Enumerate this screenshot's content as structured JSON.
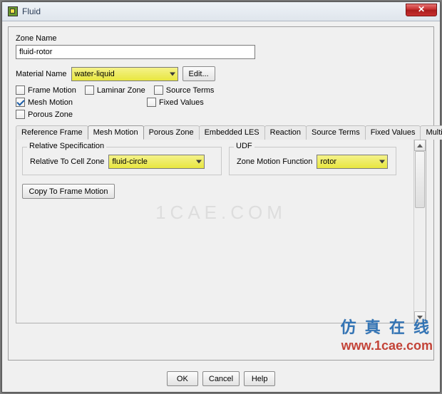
{
  "window": {
    "title": "Fluid"
  },
  "zone": {
    "name_label": "Zone Name",
    "name_value": "fluid-rotor"
  },
  "material": {
    "label": "Material Name",
    "value": "water-liquid",
    "edit_btn": "Edit..."
  },
  "checkboxes": {
    "frame_motion": "Frame Motion",
    "laminar_zone": "Laminar Zone",
    "source_terms": "Source Terms",
    "mesh_motion": "Mesh Motion",
    "fixed_values": "Fixed Values",
    "porous_zone": "Porous Zone"
  },
  "check_state": {
    "frame_motion": false,
    "laminar_zone": false,
    "source_terms": false,
    "mesh_motion": true,
    "fixed_values": false,
    "porous_zone": false
  },
  "tabs": {
    "reference_frame": "Reference Frame",
    "mesh_motion": "Mesh Motion",
    "porous_zone": "Porous Zone",
    "embedded_les": "Embedded LES",
    "reaction": "Reaction",
    "source_terms": "Source Terms",
    "fixed_values": "Fixed Values",
    "multiphase": "Multiphase",
    "active": "mesh_motion"
  },
  "mesh_motion_tab": {
    "relative_spec_legend": "Relative Specification",
    "relative_cell_label": "Relative To Cell Zone",
    "relative_cell_value": "fluid-circle",
    "udf_legend": "UDF",
    "udf_label": "Zone Motion Function",
    "udf_value": "rotor",
    "copy_btn": "Copy To Frame Motion"
  },
  "buttons": {
    "ok": "OK",
    "cancel": "Cancel",
    "help": "Help"
  },
  "watermarks": {
    "center": "1CAE.COM",
    "cn": "仿 真 在 线",
    "url": "www.1cae.com"
  }
}
